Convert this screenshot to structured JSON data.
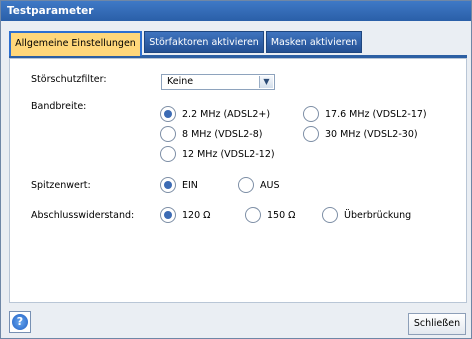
{
  "window": {
    "title": "Testparameter"
  },
  "tabs": [
    {
      "label": "Allgemeine Einstellungen",
      "active": true
    },
    {
      "label": "Störfaktoren aktivieren",
      "active": false
    },
    {
      "label": "Masken aktivieren",
      "active": false
    }
  ],
  "form": {
    "noise_filter": {
      "label": "Störschutzfilter:",
      "value": "Keine"
    },
    "bandwidth": {
      "label": "Bandbreite:",
      "options": [
        {
          "label": "2.2 MHz (ADSL2+)",
          "selected": true
        },
        {
          "label": "17.6 MHz (VDSL2-17)",
          "selected": false
        },
        {
          "label": "8 MHz (VDSL2-8)",
          "selected": false
        },
        {
          "label": "30 MHz (VDSL2-30)",
          "selected": false
        },
        {
          "label": "12 MHz (VDSL2-12)",
          "selected": false
        }
      ]
    },
    "peak": {
      "label": "Spitzenwert:",
      "options": [
        {
          "label": "EIN",
          "selected": true
        },
        {
          "label": "AUS",
          "selected": false
        }
      ]
    },
    "termination": {
      "label": "Abschlusswiderstand:",
      "options": [
        {
          "label": "120 Ω",
          "selected": true
        },
        {
          "label": "150 Ω",
          "selected": false
        },
        {
          "label": "Überbrückung",
          "selected": false
        }
      ]
    }
  },
  "footer": {
    "help_symbol": "?",
    "close_label": "Schließen"
  },
  "icons": {
    "help": "help-icon",
    "dropdown": "chevron-down-icon"
  },
  "colors": {
    "title_bar": "#2f67b3",
    "active_tab": "#ffd77a",
    "tab": "#2f5fa6"
  }
}
